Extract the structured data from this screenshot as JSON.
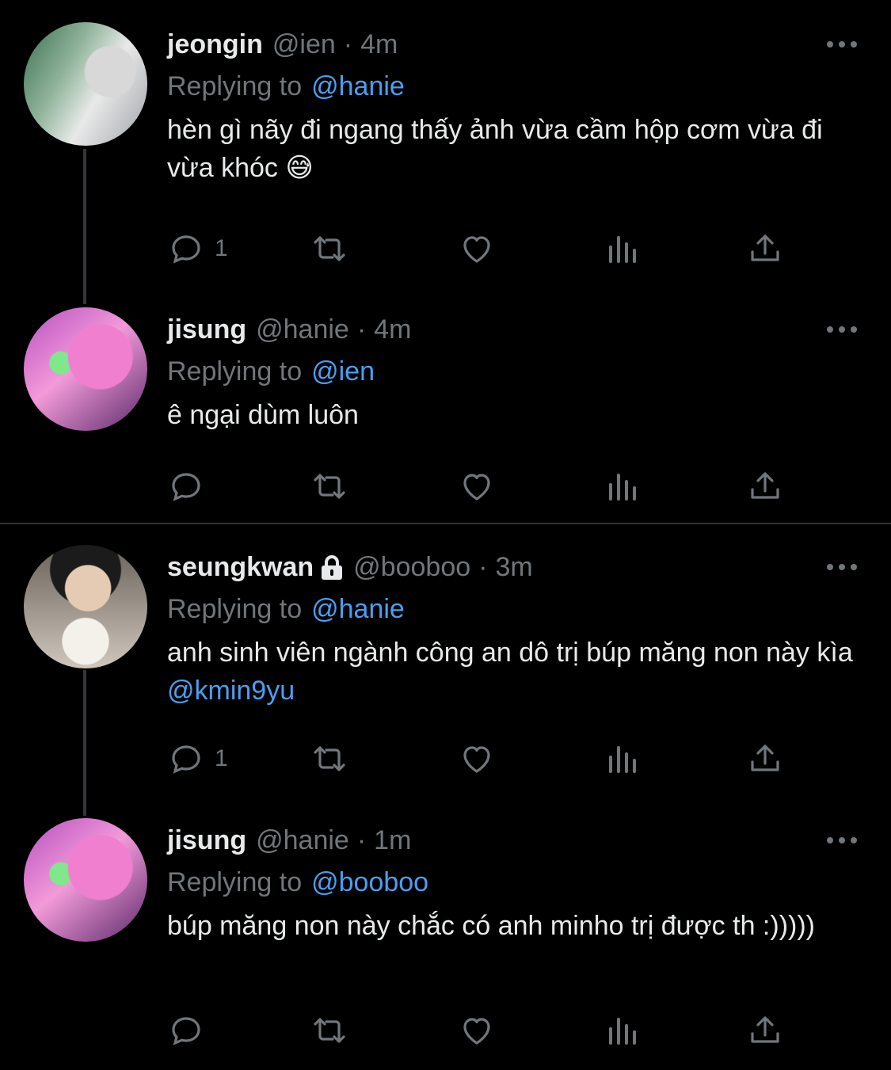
{
  "tweets": [
    {
      "name": "jeongin",
      "handle": "@ien",
      "time": "4m",
      "replying_label": "Replying to",
      "replying_to": "@hanie",
      "text": "hèn gì nãy đi ngang thấy ảnh vừa cầm hộp cơm vừa đi vừa khóc 😅",
      "reply_count": "1"
    },
    {
      "name": "jisung",
      "handle": "@hanie",
      "time": "4m",
      "replying_label": "Replying to",
      "replying_to": "@ien",
      "text": "ê ngại dùm luôn",
      "reply_count": ""
    },
    {
      "name": "seungkwan",
      "handle": "@booboo",
      "time": "3m",
      "replying_label": "Replying to",
      "replying_to": "@hanie",
      "text": "anh sinh viên ngành công an dô trị búp măng non này kìa",
      "text_mention": "@kmin9yu",
      "reply_count": "1"
    },
    {
      "name": "jisung",
      "handle": "@hanie",
      "time": "1m",
      "replying_label": "Replying to",
      "replying_to": "@booboo",
      "text": "búp măng non này chắc có anh minho trị được th :)))))",
      "reply_count": ""
    }
  ],
  "colors": {
    "background": "#000000",
    "text": "#e7e9ea",
    "muted": "#71767b",
    "link": "#4a9ff0",
    "thread_line": "#333639"
  },
  "icons": [
    "reply-icon",
    "retweet-icon",
    "like-icon",
    "views-icon",
    "share-icon",
    "more-icon",
    "lock-icon"
  ]
}
